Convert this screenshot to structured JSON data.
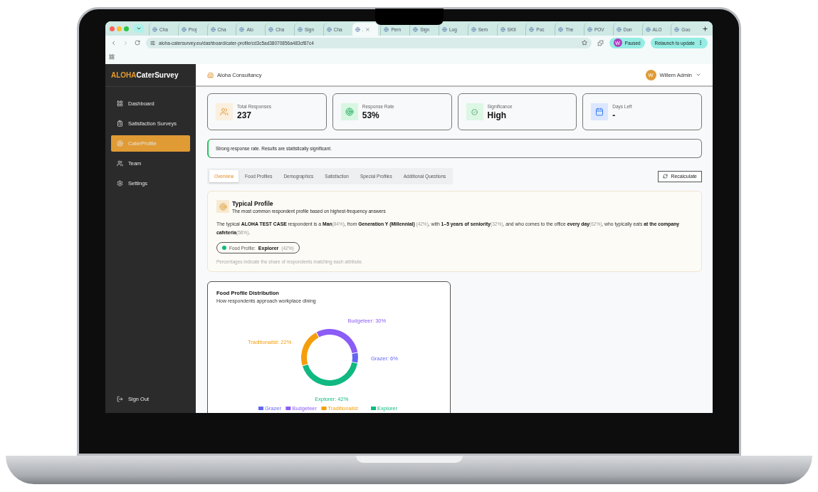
{
  "browser": {
    "tabs": [
      {
        "label": "Cha",
        "selected": false
      },
      {
        "label": "Proj",
        "selected": false
      },
      {
        "label": "Cha",
        "selected": false
      },
      {
        "label": "Alo",
        "selected": false
      },
      {
        "label": "Cha",
        "selected": false
      },
      {
        "label": "Sign",
        "selected": false
      },
      {
        "label": "Cha",
        "selected": false
      },
      {
        "label": ".",
        "selected": true
      },
      {
        "label": "Pern",
        "selected": false
      },
      {
        "label": "Sign",
        "selected": false
      },
      {
        "label": "Log",
        "selected": false
      },
      {
        "label": "Sem",
        "selected": false
      },
      {
        "label": "SKII",
        "selected": false
      },
      {
        "label": "Poc",
        "selected": false
      },
      {
        "label": "The",
        "selected": false
      },
      {
        "label": "POV",
        "selected": false
      },
      {
        "label": "Don",
        "selected": false
      },
      {
        "label": "ALO",
        "selected": false
      },
      {
        "label": "Goo",
        "selected": false
      }
    ],
    "url": "aloha-catersurvey.eu/dashboard/cater-profile/cd3c5ad38070856a483cf87c4",
    "profile": {
      "initial": "W",
      "label": "Paused"
    },
    "update_button": "Relaunch to update"
  },
  "sidebar": {
    "logo": {
      "accent": "ALOHA",
      "text": "CaterSurvey"
    },
    "items": [
      {
        "label": "Dashboard",
        "kind": "grid",
        "selected": false
      },
      {
        "label": "Satisfaction Surveys",
        "kind": "clipboard",
        "selected": false
      },
      {
        "label": "CaterProfile",
        "kind": "profile",
        "selected": true
      },
      {
        "label": "Team",
        "kind": "team",
        "selected": false
      },
      {
        "label": "Settings",
        "kind": "settings",
        "selected": false
      }
    ],
    "sign_out": "Sign Out"
  },
  "header": {
    "organization": "Aloha Consultancy",
    "user": {
      "initial": "W",
      "name": "Willem Admin"
    }
  },
  "stats": [
    {
      "label": "Total Responses",
      "value": "237",
      "kind": "users"
    },
    {
      "label": "Response Rate",
      "value": "53%",
      "kind": "target"
    },
    {
      "label": "Significance",
      "value": "High",
      "kind": "check"
    },
    {
      "label": "Days Left",
      "value": "-",
      "kind": "calendar"
    }
  ],
  "alert": {
    "text": "Strong response rate. Results are statistically significant.",
    "kind": "success"
  },
  "tabs": [
    {
      "label": "Overview",
      "selected": true
    },
    {
      "label": "Food Profiles",
      "selected": false
    },
    {
      "label": "Demographics",
      "selected": false
    },
    {
      "label": "Satisfaction",
      "selected": false
    },
    {
      "label": "Special Profiles",
      "selected": false
    },
    {
      "label": "Additional Questions",
      "selected": false
    }
  ],
  "recalculate_button": "Recalculate",
  "typical_profile": {
    "title": "Typical Profile",
    "subtitle": "The most common respondent profile based on highest-frequency answers",
    "sentence": [
      {
        "text": "The typical ",
        "kind": "plain"
      },
      {
        "text": "ALOHA TEST CASE",
        "kind": "strong"
      },
      {
        "text": " respondent is a ",
        "kind": "plain"
      },
      {
        "text": "Man",
        "kind": "strong"
      },
      {
        "text": "(84%)",
        "kind": "share"
      },
      {
        "text": ", from ",
        "kind": "plain"
      },
      {
        "text": "Generation Y (Millennial)",
        "kind": "strong"
      },
      {
        "text": " (42%)",
        "kind": "share"
      },
      {
        "text": ", with ",
        "kind": "plain"
      },
      {
        "text": "1–5 years of seniority",
        "kind": "strong"
      },
      {
        "text": "(32%)",
        "kind": "share"
      },
      {
        "text": ", and who comes to the office ",
        "kind": "plain"
      },
      {
        "text": "every day",
        "kind": "strong"
      },
      {
        "text": "(62%)",
        "kind": "share"
      },
      {
        "text": ", who typically eats ",
        "kind": "plain"
      },
      {
        "text": "at the company cafeteria",
        "kind": "strong"
      },
      {
        "text": "(56%)",
        "kind": "share"
      },
      {
        "text": ".",
        "kind": "plain"
      }
    ],
    "chip": {
      "label": "Food Profile:",
      "value": "Explorer",
      "share": "(42%)",
      "color": "#10b981"
    },
    "note": "Percentages indicate the share of respondents matching each attribute."
  },
  "distribution": {
    "title": "Food Profile Distribution",
    "subtitle": "How respondents approach workplace dining",
    "chart_data": {
      "type": "donut",
      "categories": [
        "Grazer",
        "Budgeteer",
        "Traditionalist",
        "Explorer"
      ],
      "values": [
        6,
        30,
        22,
        42
      ],
      "colors": [
        "#6366f1",
        "#8b5cf6",
        "#f59e0b",
        "#10b981"
      ],
      "legend": true,
      "value_labels": [
        "Grazer: 6%",
        "Budgeteer: 30%",
        "Traditionalist: 22%",
        "Explorer: 42%"
      ]
    }
  }
}
